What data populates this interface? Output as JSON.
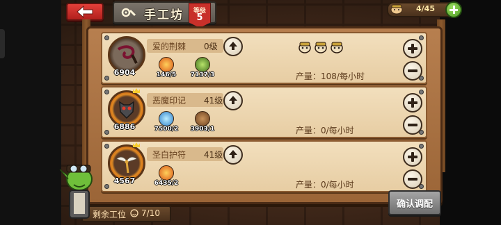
{
  "header": {
    "back_icon": "back-arrow-icon",
    "title": "手工坊",
    "level_label": "等级",
    "level_value": "5"
  },
  "workers": {
    "count": "4/45",
    "add_icon": "plus-icon"
  },
  "workshops": [
    {
      "icon": "whip-icon",
      "count": "6904",
      "name": "爱的荆棘",
      "level": "0级",
      "materials": [
        {
          "icon": "fire-material-icon",
          "text": "146/5"
        },
        {
          "icon": "leaf-material-icon",
          "text": "7137/3"
        }
      ],
      "assigned_workers": 3,
      "output": "产量：108/每小时"
    },
    {
      "icon": "demon-mask-icon",
      "count": "6886",
      "name": "恶魔印记",
      "level": "41级",
      "materials": [
        {
          "icon": "ice-material-icon",
          "text": "7500/2"
        },
        {
          "icon": "wood-material-icon",
          "text": "3903/1"
        }
      ],
      "assigned_workers": 0,
      "output": "产量：0/每小时"
    },
    {
      "icon": "winged-amulet-icon",
      "count": "4567",
      "name": "圣白护符",
      "level": "41级",
      "materials": [
        {
          "icon": "fire-material-icon",
          "text": "6435/2"
        }
      ],
      "assigned_workers": 0,
      "output": "产量：0/每小时"
    }
  ],
  "footer": {
    "slots_label": "剩余工位",
    "slots_count": "7/10",
    "confirm_label": "确认调配"
  },
  "colors": {
    "board": "#a86f40",
    "row": "#eed8b2",
    "back_button": "#c8302a",
    "plus_button": "#5aa82b"
  }
}
